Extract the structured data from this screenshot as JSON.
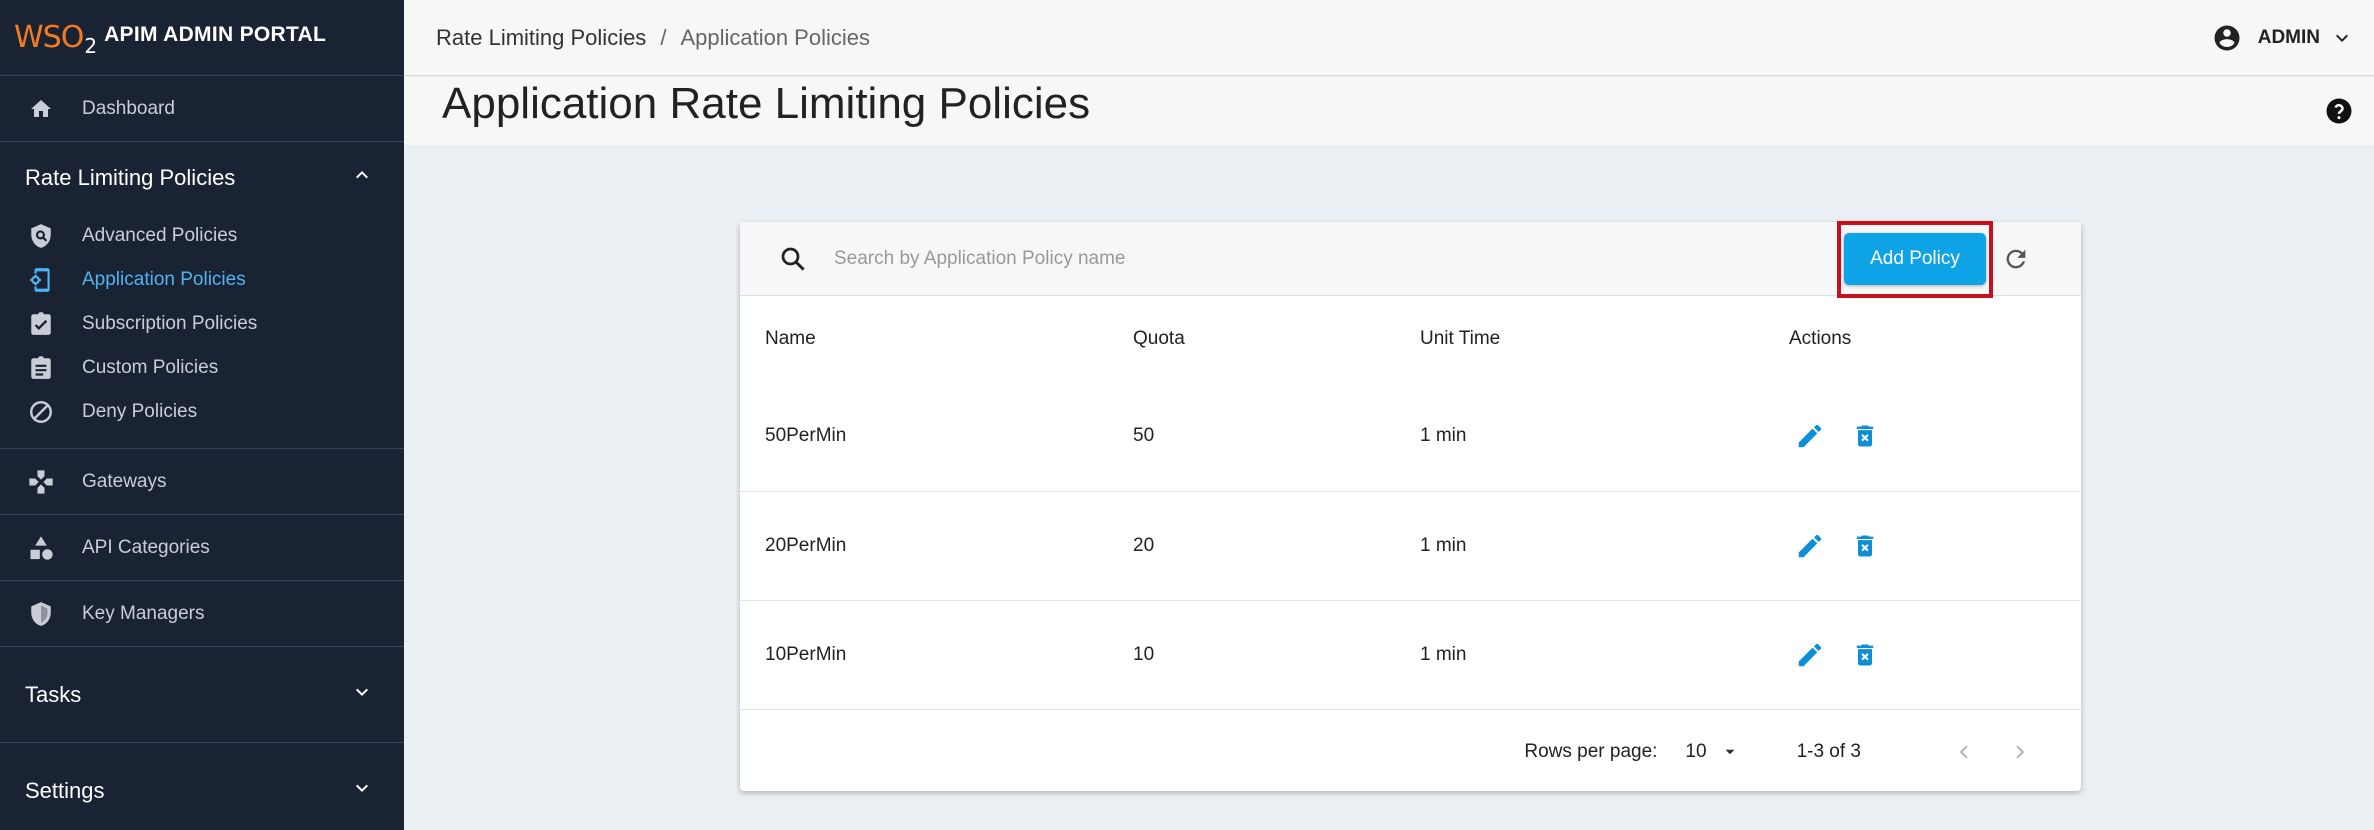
{
  "brand": {
    "logo_text": "WSO",
    "logo_sub": "2",
    "title": "APIM ADMIN PORTAL"
  },
  "sidebar": {
    "dashboard": {
      "label": "Dashboard",
      "icon": "home-icon"
    },
    "rate_limiting": {
      "label": "Rate Limiting Policies",
      "expanded": true,
      "items": [
        {
          "label": "Advanced Policies",
          "icon": "shield-search-icon"
        },
        {
          "label": "Application Policies",
          "icon": "app-settings-icon",
          "active": true
        },
        {
          "label": "Subscription Policies",
          "icon": "clipboard-check-icon"
        },
        {
          "label": "Custom Policies",
          "icon": "clipboard-list-icon"
        },
        {
          "label": "Deny Policies",
          "icon": "block-icon"
        }
      ]
    },
    "gateways": {
      "label": "Gateways",
      "icon": "gamepad-icon"
    },
    "api_categories": {
      "label": "API Categories",
      "icon": "shapes-icon"
    },
    "key_managers": {
      "label": "Key Managers",
      "icon": "shield-icon"
    },
    "tasks": {
      "label": "Tasks"
    },
    "settings": {
      "label": "Settings"
    }
  },
  "topbar": {
    "breadcrumb": [
      "Rate Limiting Policies",
      "Application Policies"
    ],
    "separator": "/",
    "user": "ADMIN"
  },
  "page": {
    "title": "Application Rate Limiting Policies"
  },
  "search": {
    "placeholder": "Search by Application Policy name",
    "value": ""
  },
  "toolbar": {
    "add_label": "Add Policy"
  },
  "table": {
    "headers": [
      "Name",
      "Quota",
      "Unit Time",
      "Actions"
    ],
    "rows": [
      {
        "name": "50PerMin",
        "quota": "50",
        "unit_time": "1 min"
      },
      {
        "name": "20PerMin",
        "quota": "20",
        "unit_time": "1 min"
      },
      {
        "name": "10PerMin",
        "quota": "10",
        "unit_time": "1 min"
      }
    ]
  },
  "pagination": {
    "rows_per_page_label": "Rows per page:",
    "rows_per_page": "10",
    "range": "1-3 of 3"
  },
  "colors": {
    "sidebar_bg": "#1a2333",
    "accent": "#0da3e6",
    "active_nav": "#4fb3f0",
    "highlight": "#c8101e"
  }
}
